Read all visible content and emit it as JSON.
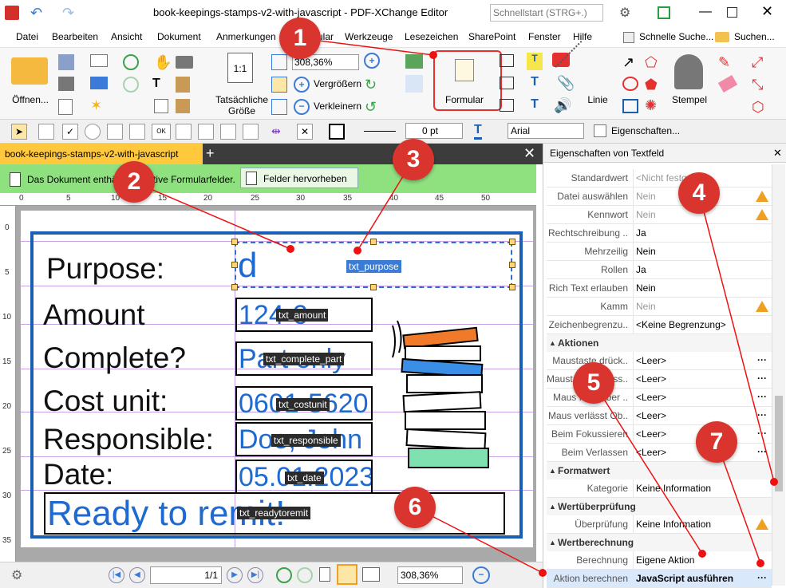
{
  "window": {
    "title": "book-keepings-stamps-v2-with-javascript - PDF-XChange Editor",
    "search_placeholder": "Schnellstart (STRG+.)"
  },
  "menu": [
    "Datei",
    "Bearbeiten",
    "Ansicht",
    "Dokument",
    "Anmerkungen",
    "Formular",
    "Werkzeuge",
    "Lesezeichen",
    "SharePoint",
    "Fenster",
    "Hilfe"
  ],
  "menu_right": {
    "quick_search": "Schnelle Suche...",
    "search": "Suchen..."
  },
  "ribbon": {
    "open": "Öffnen...",
    "actual_size_line1": "Tatsächliche",
    "actual_size_line2": "Größe",
    "actual_size_icon": "1:1",
    "zoom_value": "308,36%",
    "zoom_in": "Vergrößern",
    "zoom_out": "Verkleinern",
    "form": "Formular",
    "line": "Linie",
    "stamp": "Stempel"
  },
  "toolbar": {
    "line_width": "0 pt",
    "font": "Arial",
    "properties": "Eigenschaften..."
  },
  "doc_tab": {
    "label": "book-keepings-stamps-v2-with-javascript"
  },
  "notification": {
    "text": "Das Dokument enthält interaktive Formularfelder.",
    "button": "Felder hervorheben"
  },
  "ruler_h": [
    "0",
    "5",
    "10",
    "15",
    "20",
    "25",
    "30",
    "35",
    "40",
    "45",
    "50"
  ],
  "ruler_v": [
    "0",
    "5",
    "10",
    "15",
    "20",
    "25",
    "30",
    "35"
  ],
  "form": {
    "labels": [
      "Purpose:",
      "Amount",
      "Complete?",
      "Cost unit:",
      "Responsible:",
      "Date:"
    ],
    "values": {
      "purpose": "d",
      "amount": "124 €",
      "complete": "Part only",
      "costunit": "0601-5620",
      "responsible": "Doe, John",
      "date": "05.01.2023",
      "readytoremit": "Ready to remit!"
    },
    "tags": {
      "purpose": "txt_purpose",
      "amount": "txt_amount",
      "complete": "txt_complete_part",
      "costunit": "txt_costunit",
      "responsible": "txt_responsible",
      "date": "txt_date",
      "readytoremit": "txt_readytoremit"
    }
  },
  "panel": {
    "title": "Eigenschaften von Textfeld",
    "rows": [
      {
        "label": "Standardwert",
        "value": "<Nicht festgelegt>",
        "gray": true,
        "warn": false
      },
      {
        "label": "Datei auswählen",
        "value": "Nein",
        "gray": true,
        "warn": true
      },
      {
        "label": "Kennwort",
        "value": "Nein",
        "gray": true,
        "warn": true
      },
      {
        "label": "Rechtschreibung ..",
        "value": "Ja",
        "gray": false,
        "warn": false
      },
      {
        "label": "Mehrzeilig",
        "value": "Nein",
        "gray": false,
        "warn": false
      },
      {
        "label": "Rollen",
        "value": "Ja",
        "gray": false,
        "warn": false
      },
      {
        "label": "Rich Text erlauben",
        "value": "Nein",
        "gray": false,
        "warn": false
      },
      {
        "label": "Kamm",
        "value": "Nein",
        "gray": true,
        "warn": true
      },
      {
        "label": "Zeichenbegrenzu..",
        "value": "<Keine Begrenzung>",
        "gray": false,
        "warn": false
      }
    ],
    "sections": {
      "actions": "Aktionen",
      "format": "Formatwert",
      "validation": "Wertüberprüfung",
      "calc": "Wertberechnung"
    },
    "action_rows": [
      {
        "label": "Maustaste drück..",
        "value": "<Leer>"
      },
      {
        "label": "Maustaste loslass..",
        "value": "<Leer>"
      },
      {
        "label": "Maus fährt über ..",
        "value": "<Leer>"
      },
      {
        "label": "Maus verlässt Ob..",
        "value": "<Leer>"
      },
      {
        "label": "Beim Fokussieren",
        "value": "<Leer>"
      },
      {
        "label": "Beim Verlassen",
        "value": "<Leer>"
      }
    ],
    "format_row": {
      "label": "Kategorie",
      "value": "Keine Information"
    },
    "validation_row": {
      "label": "Überprüfung",
      "value": "Keine Information"
    },
    "calc_rows": [
      {
        "label": "Berechnung",
        "value": "Eigene Aktion"
      },
      {
        "label": "Aktion berechnen",
        "value": "JavaScript ausführen"
      }
    ]
  },
  "status": {
    "page": "1/1",
    "zoom": "308,36%"
  },
  "callouts": [
    "1",
    "2",
    "3",
    "4",
    "5",
    "6",
    "7"
  ],
  "colors": {
    "accent": "#1a5fb4",
    "callout": "#d9352e",
    "notify": "#8fe07f",
    "tab": "#ffc83d"
  }
}
